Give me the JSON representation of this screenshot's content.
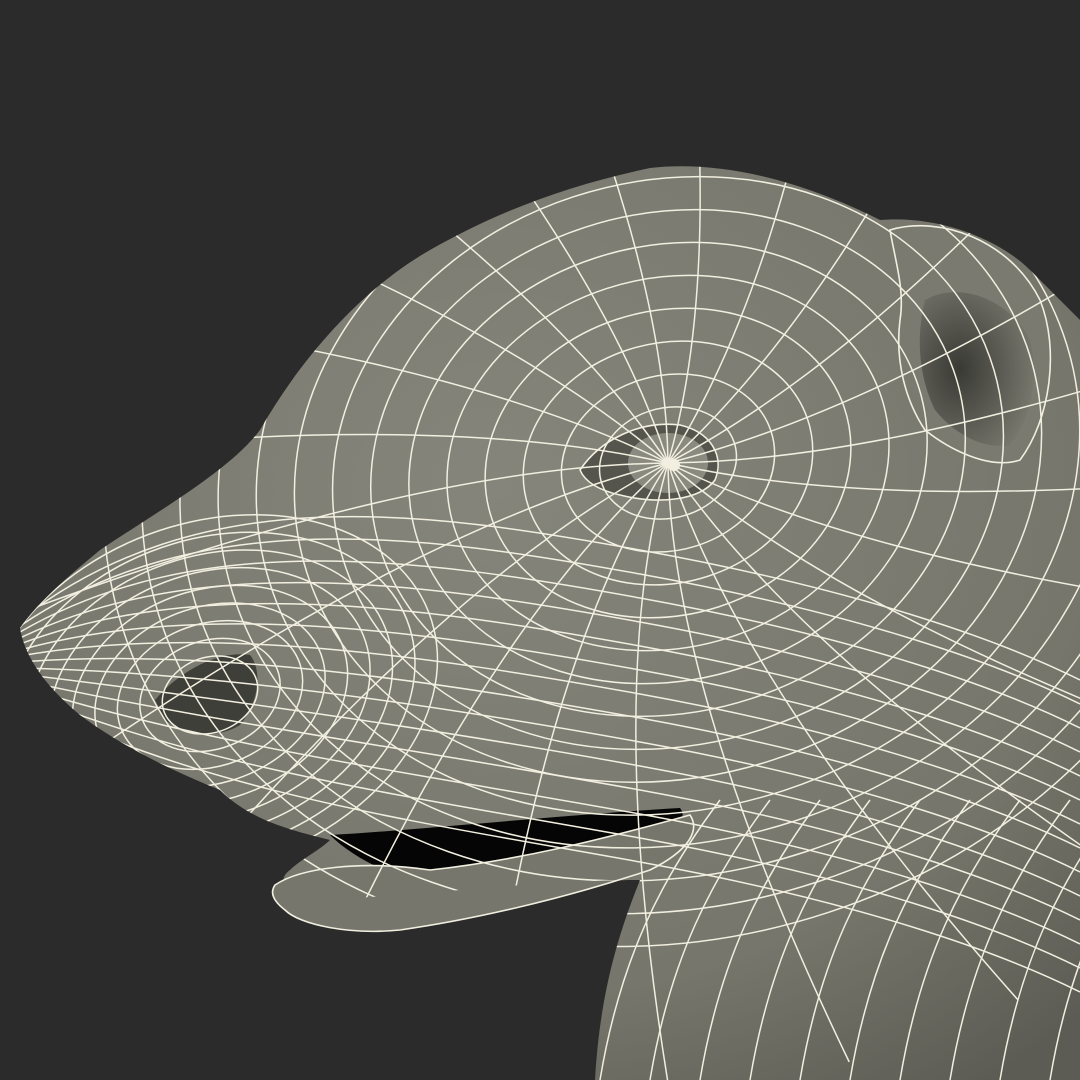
{
  "scene": {
    "subject": "dog-head-wireframe",
    "background_color": "#2b2b2b",
    "surface_color": "#7a7a70",
    "surface_shadow_color": "#4a4a44",
    "wire_color": "#f2efe0",
    "cavity_color": "#050505"
  }
}
